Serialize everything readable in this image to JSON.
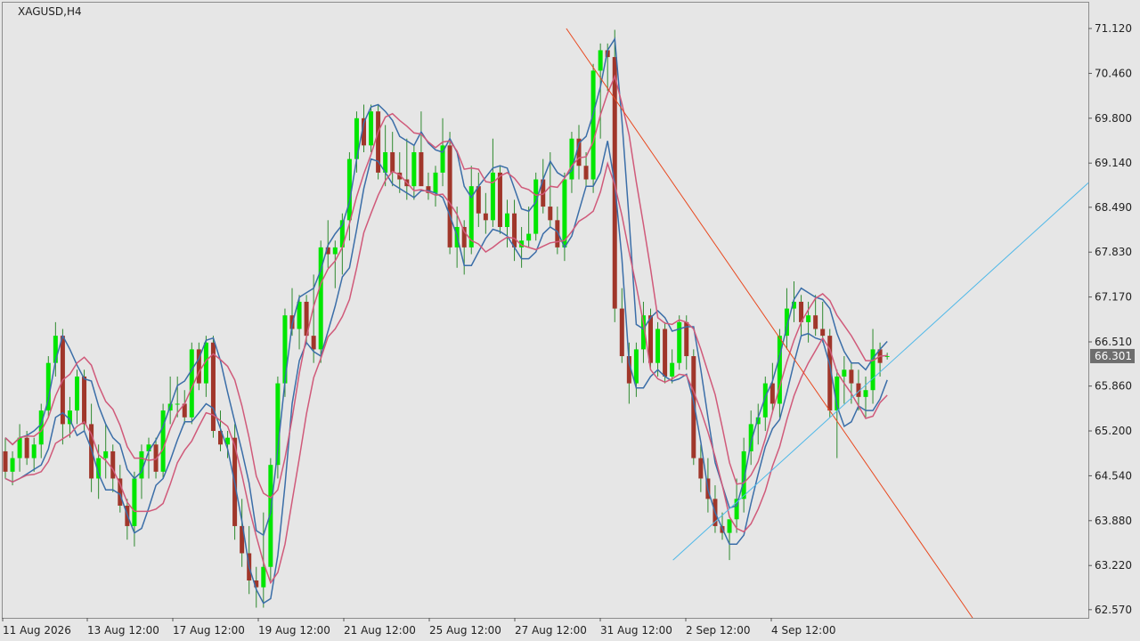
{
  "window_title": "XAGUSD,H4",
  "price_tag": "66.301",
  "colors": {
    "background": "#e6e6e6",
    "border": "#8c8c8c",
    "bull": "#00e600",
    "bear": "#a0362a",
    "wick": "#2f8a2f",
    "ma_blue": "#3b6ea8",
    "ma_pink": "#d05a7a",
    "trendline_red": "#e8481f",
    "trendline_blue": "#4fb8e8",
    "price_tag_bg": "#6e6e6e",
    "price_tag_text": "#ffffff"
  },
  "chart_data": {
    "type": "candlestick",
    "symbol": "XAGUSD",
    "timeframe": "H4",
    "y_ticks": [
      "71.120",
      "70.460",
      "69.800",
      "69.140",
      "68.490",
      "67.830",
      "67.170",
      "66.510",
      "65.860",
      "65.200",
      "64.540",
      "63.880",
      "63.220",
      "62.570"
    ],
    "x_ticks": [
      "11 Aug 2026",
      "13 Aug 12:00",
      "17 Aug 12:00",
      "19 Aug 12:00",
      "21 Aug 12:00",
      "25 Aug 12:00",
      "27 Aug 12:00",
      "31 Aug 12:00",
      "2 Sep 12:00",
      "4 Sep 12:00"
    ],
    "ylim": [
      62.45,
      71.5
    ],
    "current_price": 66.301,
    "candles": [
      [
        64.9,
        65.1,
        64.5,
        64.6
      ],
      [
        64.6,
        64.9,
        64.4,
        64.8
      ],
      [
        64.8,
        65.3,
        64.6,
        65.1
      ],
      [
        65.1,
        65.2,
        64.7,
        64.8
      ],
      [
        64.8,
        65.1,
        64.6,
        65.0
      ],
      [
        65.0,
        65.6,
        64.8,
        65.5
      ],
      [
        65.5,
        66.3,
        65.4,
        66.2
      ],
      [
        66.2,
        66.8,
        66.0,
        66.6
      ],
      [
        66.6,
        66.7,
        65.0,
        65.3
      ],
      [
        65.3,
        65.7,
        65.1,
        65.5
      ],
      [
        65.5,
        66.1,
        65.3,
        66.0
      ],
      [
        66.0,
        66.1,
        65.2,
        65.3
      ],
      [
        65.3,
        65.6,
        64.3,
        64.5
      ],
      [
        64.5,
        65.0,
        64.2,
        64.8
      ],
      [
        64.8,
        65.3,
        64.5,
        64.9
      ],
      [
        64.9,
        65.0,
        64.3,
        64.5
      ],
      [
        64.5,
        64.7,
        64.0,
        64.1
      ],
      [
        64.1,
        64.2,
        63.6,
        63.8
      ],
      [
        63.8,
        64.6,
        63.5,
        64.5
      ],
      [
        64.5,
        65.0,
        64.2,
        64.9
      ],
      [
        64.9,
        65.1,
        64.5,
        65.0
      ],
      [
        65.0,
        65.1,
        64.5,
        64.6
      ],
      [
        64.6,
        65.6,
        64.5,
        65.5
      ],
      [
        65.5,
        66.0,
        65.3,
        65.6
      ],
      [
        65.6,
        66.0,
        65.4,
        65.6
      ],
      [
        65.6,
        65.8,
        65.3,
        65.4
      ],
      [
        65.4,
        66.5,
        65.3,
        66.4
      ],
      [
        66.4,
        66.5,
        65.8,
        65.9
      ],
      [
        65.9,
        66.6,
        65.7,
        66.5
      ],
      [
        66.5,
        66.6,
        65.1,
        65.2
      ],
      [
        65.2,
        65.5,
        64.9,
        65.0
      ],
      [
        65.0,
        65.2,
        64.8,
        65.1
      ],
      [
        65.1,
        65.3,
        63.6,
        63.8
      ],
      [
        63.8,
        64.2,
        63.2,
        63.4
      ],
      [
        63.4,
        63.8,
        62.8,
        63.0
      ],
      [
        63.0,
        63.2,
        62.6,
        62.9
      ],
      [
        62.9,
        64.0,
        62.6,
        63.2
      ],
      [
        63.2,
        64.8,
        63.0,
        64.7
      ],
      [
        64.7,
        66.0,
        64.5,
        65.9
      ],
      [
        65.9,
        67.0,
        65.7,
        66.9
      ],
      [
        66.9,
        67.3,
        66.6,
        66.7
      ],
      [
        66.7,
        67.2,
        66.4,
        67.1
      ],
      [
        67.1,
        67.2,
        66.5,
        66.6
      ],
      [
        66.6,
        67.5,
        66.2,
        66.4
      ],
      [
        66.4,
        68.0,
        66.2,
        67.9
      ],
      [
        67.9,
        68.3,
        67.6,
        67.8
      ],
      [
        67.8,
        68.0,
        67.3,
        67.9
      ],
      [
        67.9,
        68.4,
        67.5,
        68.3
      ],
      [
        68.3,
        69.3,
        68.0,
        69.2
      ],
      [
        69.2,
        69.9,
        69.0,
        69.8
      ],
      [
        69.8,
        70.0,
        69.3,
        69.4
      ],
      [
        69.4,
        70.0,
        69.3,
        69.9
      ],
      [
        69.9,
        70.0,
        68.9,
        69.0
      ],
      [
        69.0,
        69.7,
        68.8,
        69.3
      ],
      [
        69.3,
        69.6,
        68.8,
        69.0
      ],
      [
        69.0,
        69.3,
        68.7,
        68.9
      ],
      [
        68.9,
        69.5,
        68.6,
        68.8
      ],
      [
        68.8,
        69.4,
        68.6,
        69.3
      ],
      [
        69.3,
        69.9,
        69.0,
        68.8
      ],
      [
        68.8,
        69.0,
        68.6,
        68.7
      ],
      [
        68.7,
        69.1,
        68.5,
        69.0
      ],
      [
        69.0,
        69.8,
        68.8,
        69.4
      ],
      [
        69.4,
        69.6,
        67.8,
        67.9
      ],
      [
        67.9,
        68.5,
        67.6,
        68.2
      ],
      [
        68.2,
        68.3,
        67.5,
        67.9
      ],
      [
        67.9,
        69.1,
        67.8,
        68.8
      ],
      [
        68.8,
        69.0,
        68.2,
        68.4
      ],
      [
        68.4,
        68.7,
        68.1,
        68.3
      ],
      [
        68.3,
        69.5,
        68.2,
        69.0
      ],
      [
        69.0,
        69.1,
        68.1,
        68.2
      ],
      [
        68.2,
        68.6,
        67.9,
        68.4
      ],
      [
        68.4,
        68.6,
        67.7,
        67.9
      ],
      [
        67.9,
        68.2,
        67.6,
        68.0
      ],
      [
        68.0,
        68.5,
        67.9,
        68.1
      ],
      [
        68.1,
        69.0,
        68.0,
        68.9
      ],
      [
        68.9,
        69.2,
        68.4,
        68.5
      ],
      [
        68.5,
        69.3,
        68.2,
        68.3
      ],
      [
        68.3,
        68.5,
        67.8,
        67.9
      ],
      [
        67.9,
        69.0,
        67.7,
        68.9
      ],
      [
        68.9,
        69.6,
        68.7,
        69.5
      ],
      [
        69.5,
        69.7,
        68.9,
        69.1
      ],
      [
        69.1,
        69.3,
        68.8,
        68.9
      ],
      [
        68.9,
        70.6,
        68.7,
        70.5
      ],
      [
        70.5,
        70.9,
        69.5,
        70.8
      ],
      [
        70.8,
        70.9,
        70.2,
        70.7
      ],
      [
        70.7,
        71.1,
        66.8,
        67.0
      ],
      [
        67.0,
        67.3,
        66.2,
        66.3
      ],
      [
        66.3,
        66.5,
        65.6,
        65.9
      ],
      [
        65.9,
        66.5,
        65.7,
        66.4
      ],
      [
        66.4,
        67.1,
        66.2,
        66.9
      ],
      [
        66.9,
        67.0,
        66.1,
        66.2
      ],
      [
        66.2,
        66.8,
        66.0,
        66.7
      ],
      [
        66.7,
        66.8,
        65.9,
        66.0
      ],
      [
        66.0,
        66.4,
        65.9,
        66.2
      ],
      [
        66.2,
        66.9,
        66.1,
        66.8
      ],
      [
        66.8,
        66.9,
        66.1,
        66.3
      ],
      [
        66.3,
        66.4,
        64.7,
        64.8
      ],
      [
        64.8,
        65.0,
        64.3,
        64.5
      ],
      [
        64.5,
        64.8,
        64.0,
        64.2
      ],
      [
        64.2,
        64.4,
        63.7,
        63.8
      ],
      [
        63.8,
        64.0,
        63.6,
        63.7
      ],
      [
        63.7,
        63.8,
        63.3,
        63.9
      ],
      [
        63.9,
        64.5,
        63.7,
        64.2
      ],
      [
        64.2,
        65.1,
        64.0,
        64.9
      ],
      [
        64.9,
        65.5,
        64.7,
        65.3
      ],
      [
        65.3,
        65.6,
        65.0,
        65.4
      ],
      [
        65.4,
        66.0,
        65.2,
        65.9
      ],
      [
        65.9,
        66.2,
        65.5,
        65.6
      ],
      [
        65.6,
        66.7,
        65.4,
        66.6
      ],
      [
        66.6,
        67.3,
        66.4,
        67.0
      ],
      [
        67.0,
        67.4,
        66.8,
        67.1
      ],
      [
        67.1,
        67.2,
        66.6,
        66.8
      ],
      [
        66.8,
        67.1,
        66.5,
        66.9
      ],
      [
        66.9,
        67.2,
        66.6,
        66.7
      ],
      [
        66.7,
        67.1,
        66.5,
        66.6
      ],
      [
        66.6,
        66.7,
        65.4,
        65.5
      ],
      [
        65.5,
        66.1,
        64.8,
        66.0
      ],
      [
        66.0,
        66.3,
        65.6,
        66.1
      ],
      [
        66.1,
        66.2,
        65.6,
        65.9
      ],
      [
        65.9,
        66.1,
        65.5,
        65.7
      ],
      [
        65.7,
        66.0,
        65.4,
        65.8
      ],
      [
        65.8,
        66.7,
        65.6,
        66.4
      ],
      [
        66.4,
        66.5,
        66.0,
        66.2
      ],
      [
        66.3,
        66.35,
        66.25,
        66.301
      ]
    ]
  }
}
